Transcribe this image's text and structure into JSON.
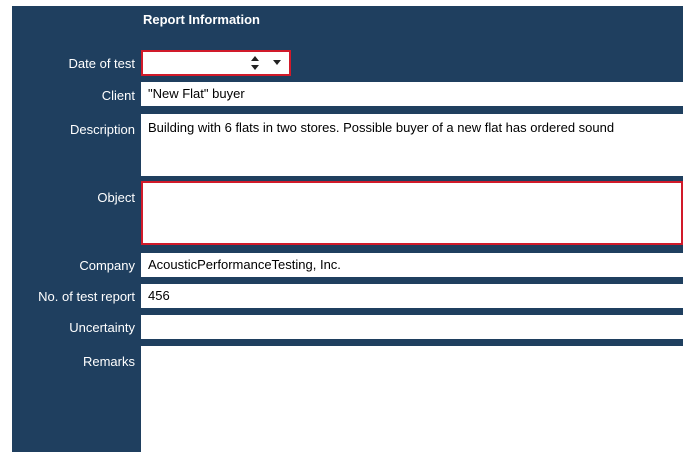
{
  "section": {
    "title": "Report Information"
  },
  "labels": {
    "date_of_test": "Date of test",
    "client": "Client",
    "description": "Description",
    "object": "Object",
    "company": "Company",
    "test_report_no": "No. of test report",
    "uncertainty": "Uncertainty",
    "remarks": "Remarks"
  },
  "values": {
    "date_of_test": "",
    "client": "\"New Flat\" buyer",
    "description": "Building with 6 flats in two stores. Possible buyer of a new flat has ordered sound",
    "object": "",
    "company": "AcousticPerformanceTesting, Inc.",
    "test_report_no": "456",
    "uncertainty": "",
    "remarks": ""
  },
  "colors": {
    "panel_bg": "#1f3f5f",
    "label_text": "#ffffff",
    "error_border": "#d11a2a"
  },
  "icons": {
    "date_spinner": "up-down-arrows-icon",
    "date_dropdown": "chevron-down-icon"
  }
}
